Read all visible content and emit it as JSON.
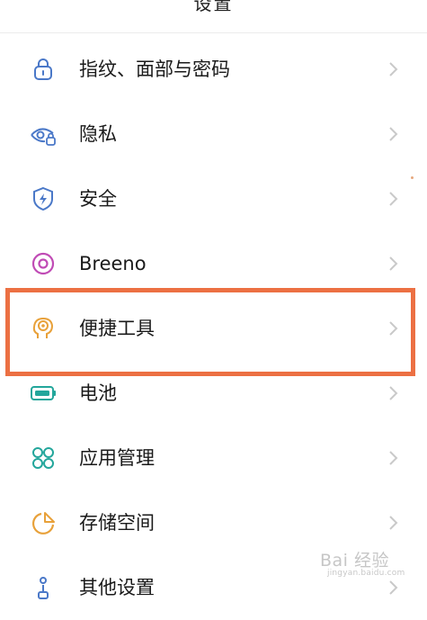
{
  "header": {
    "title": "设置"
  },
  "items": [
    {
      "label": "指纹、面部与密码",
      "icon": "lock-icon",
      "color": "#4a78c8"
    },
    {
      "label": "隐私",
      "icon": "privacy-eye-lock-icon",
      "color": "#4a78c8"
    },
    {
      "label": "安全",
      "icon": "shield-bolt-icon",
      "color": "#4a78c8"
    },
    {
      "label": "Breeno",
      "icon": "breeno-ring-icon",
      "color": "#c04bb5"
    },
    {
      "label": "便捷工具",
      "icon": "head-target-icon",
      "color": "#e8a13a"
    },
    {
      "label": "电池",
      "icon": "battery-icon",
      "color": "#23a69b"
    },
    {
      "label": "应用管理",
      "icon": "apps-grid-icon",
      "color": "#23a69b"
    },
    {
      "label": "存储空间",
      "icon": "storage-pie-icon",
      "color": "#e8a13a"
    },
    {
      "label": "其他设置",
      "icon": "other-settings-icon",
      "color": "#4a78c8"
    }
  ],
  "highlight": {
    "color": "#ec7043",
    "target": "便捷工具"
  },
  "watermark": {
    "main": "Bai 经验",
    "sub": "jingyan.baidu.com"
  }
}
